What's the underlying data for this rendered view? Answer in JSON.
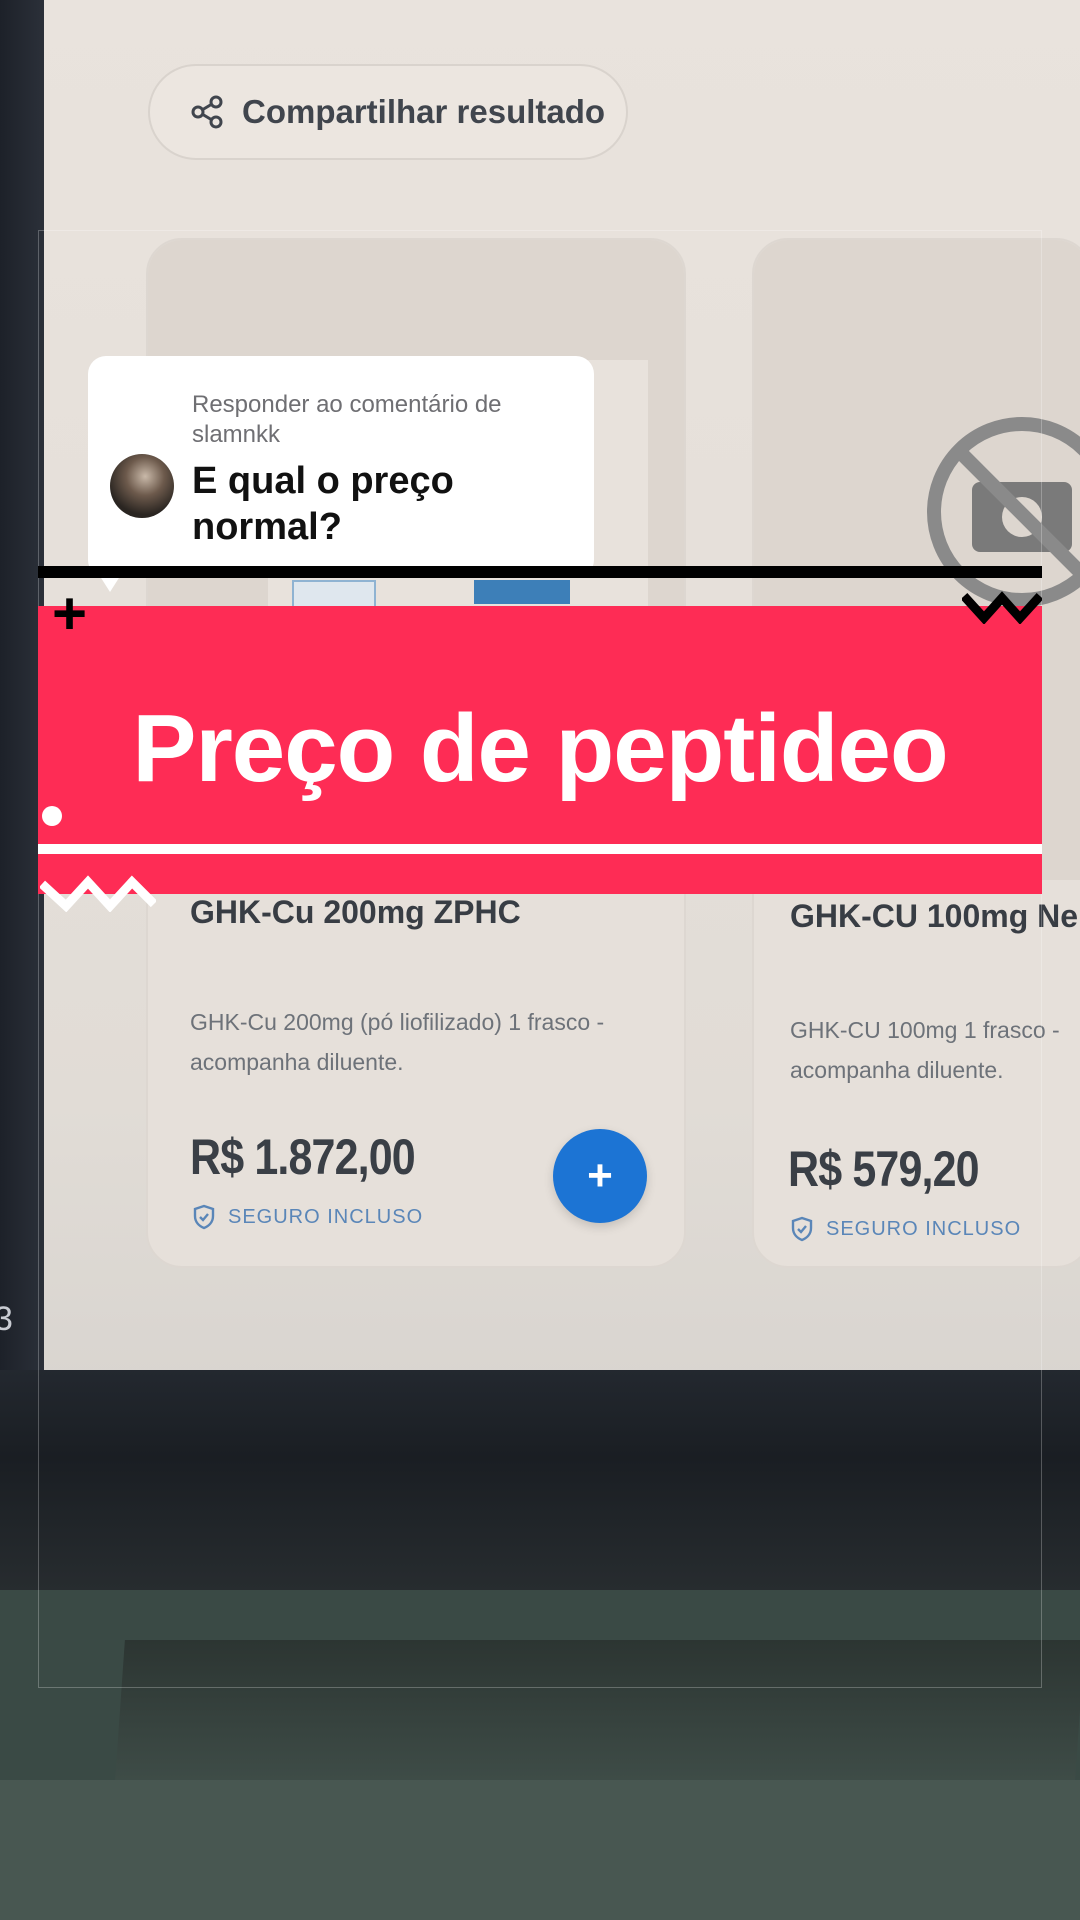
{
  "share": {
    "label": "Compartilhar resultado",
    "icon": "share-icon"
  },
  "products": [
    {
      "title": "GHK-Cu 200mg ZPHC",
      "description": "GHK-Cu 200mg (pó liofilizado) 1 frasco - acompanha diluente.",
      "price": "R$ 1.872,00",
      "insured": "SEGURO INCLUSO",
      "add_label": "+"
    },
    {
      "title": "GHK-CU 100mg Ne",
      "description": "GHK-CU 100mg 1 frasco - acompanha diluente.",
      "price": "R$ 579,20",
      "insured": "SEGURO INCLUSO",
      "image_state": "no-image-icon"
    }
  ],
  "reply": {
    "header": "Responder ao comentário de slamnkk",
    "text": "E qual o preço normal?"
  },
  "banner": {
    "title": "Preço de peptideo"
  },
  "side_glyph": "3",
  "colors": {
    "banner_red": "#fe2c55",
    "add_button_blue": "#1c74d4",
    "insured_blue": "#5a86b8"
  }
}
